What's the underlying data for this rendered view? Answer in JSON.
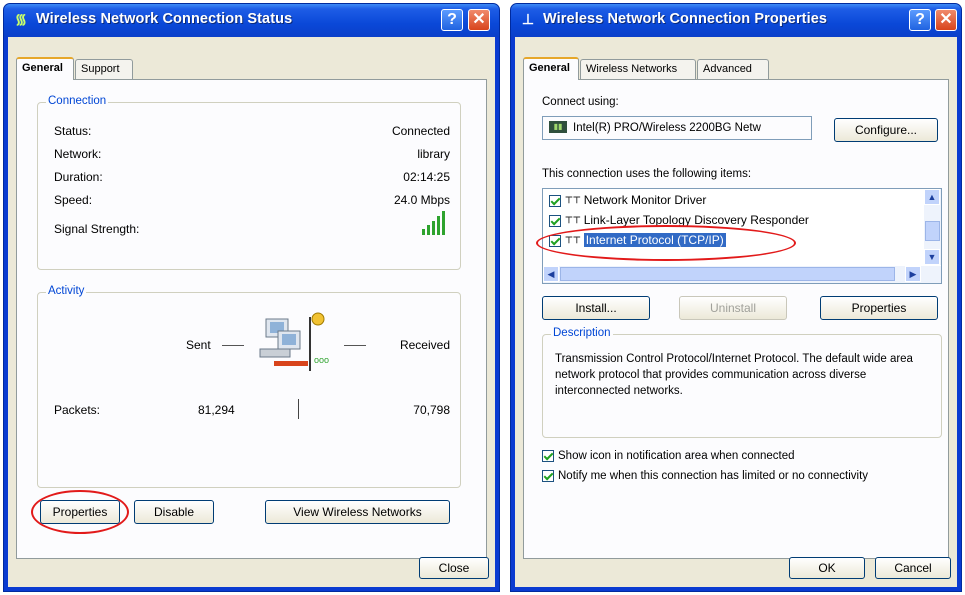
{
  "status_window": {
    "title": "Wireless Network Connection Status",
    "title_icon": "wireless-network-icon",
    "help_label": "?",
    "close_label": "✕",
    "tabs": [
      "General",
      "Support"
    ],
    "connection": {
      "group_label": "Connection",
      "rows": [
        {
          "label": "Status:",
          "value": "Connected"
        },
        {
          "label": "Network:",
          "value": "library"
        },
        {
          "label": "Duration:",
          "value": "02:14:25"
        },
        {
          "label": "Speed:",
          "value": "24.0 Mbps"
        },
        {
          "label": "Signal Strength:",
          "value": ""
        }
      ]
    },
    "activity": {
      "group_label": "Activity",
      "sent_label": "Sent",
      "received_label": "Received",
      "packets_label": "Packets:",
      "packets_sent": "81,294",
      "packets_received": "70,798"
    },
    "buttons": {
      "properties": "Properties",
      "disable": "Disable",
      "view_networks": "View Wireless Networks",
      "close": "Close"
    }
  },
  "properties_window": {
    "title": "Wireless Network Connection Properties",
    "title_icon": "network-connection-icon",
    "help_label": "?",
    "close_label": "✕",
    "tabs": [
      "General",
      "Wireless Networks",
      "Advanced"
    ],
    "connect_using_label": "Connect using:",
    "adapter_name": "Intel(R) PRO/Wireless 2200BG Netw",
    "configure_button": "Configure...",
    "items_label": "This connection uses the following items:",
    "items": [
      {
        "label": "Network Monitor Driver",
        "checked": true
      },
      {
        "label": "Link-Layer Topology Discovery Responder",
        "checked": true
      },
      {
        "label": "Internet Protocol (TCP/IP)",
        "checked": true,
        "selected": true
      }
    ],
    "install_button": "Install...",
    "uninstall_button": "Uninstall",
    "properties_button": "Properties",
    "description": {
      "group_label": "Description",
      "text": "Transmission Control Protocol/Internet Protocol. The default wide area network protocol that provides communication across diverse interconnected networks."
    },
    "show_icon_label": "Show icon in notification area when connected",
    "notify_label": "Notify me when this connection has limited or no connectivity",
    "ok_button": "OK",
    "cancel_button": "Cancel"
  }
}
